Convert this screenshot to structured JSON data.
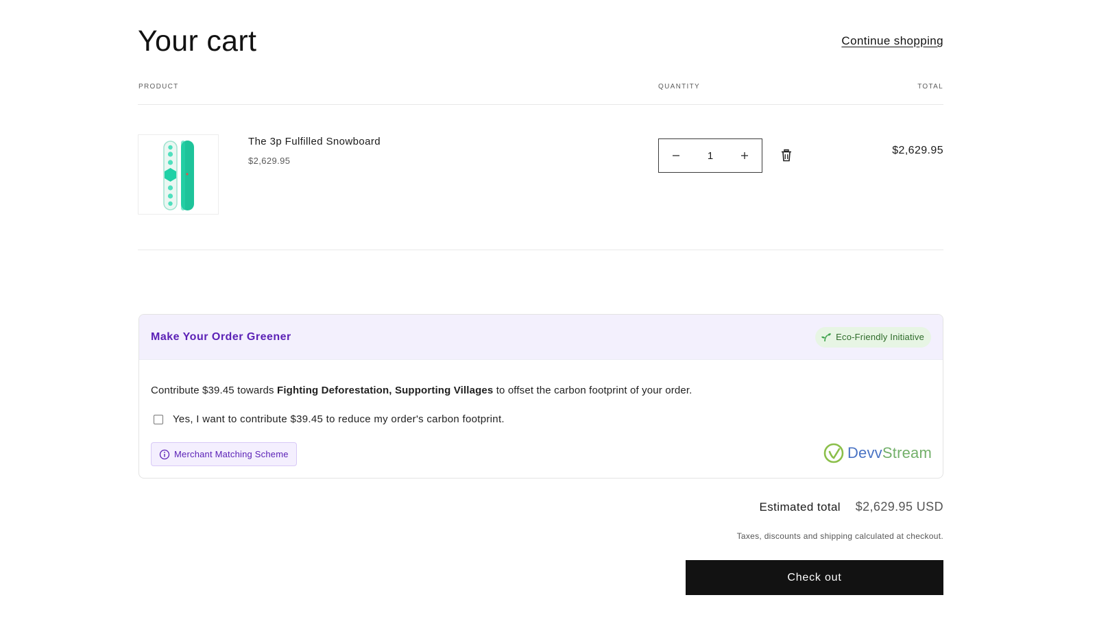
{
  "header": {
    "title": "Your cart",
    "continue_label": "Continue shopping"
  },
  "table": {
    "columns": [
      "PRODUCT",
      "QUANTITY",
      "TOTAL"
    ]
  },
  "items": [
    {
      "name": "The 3p Fulfilled Snowboard",
      "price": "$2,629.95",
      "quantity": "1",
      "total": "$2,629.95"
    }
  ],
  "eco": {
    "title": "Make Your Order Greener",
    "badge": "Eco-Friendly Initiative",
    "text_prefix": "Contribute $39.45 towards ",
    "text_bold": "Fighting Deforestation, Supporting Villages",
    "text_suffix": " to offset the carbon footprint of your order.",
    "checkbox_label": "Yes, I want to contribute $39.45 to reduce my order's carbon footprint.",
    "checkbox_checked": false,
    "merchant_label": "Merchant Matching Scheme",
    "brand_part1": "Devv",
    "brand_part2": "Stream",
    "accent": "#5b21b6"
  },
  "summary": {
    "estimated_label": "Estimated total",
    "estimated_value": "$2,629.95 USD",
    "tax_note": "Taxes, discounts and shipping calculated at checkout.",
    "checkout_label": "Check out"
  }
}
